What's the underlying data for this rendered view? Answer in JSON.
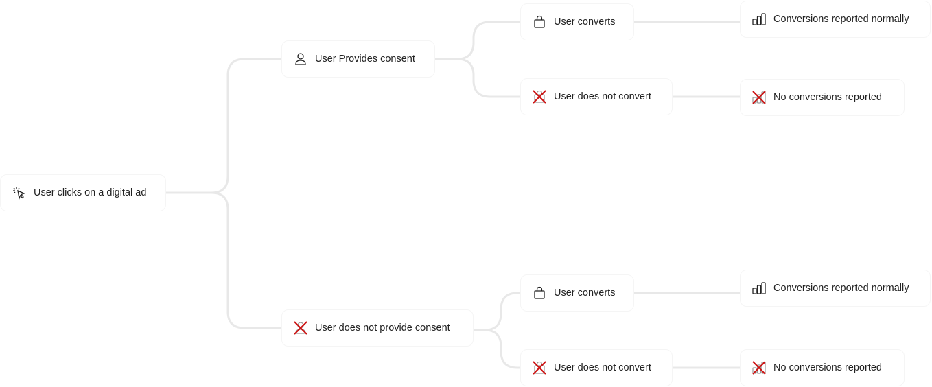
{
  "nodes": {
    "root": {
      "label": "User clicks on a digital ad",
      "icon": "cursor-click-icon"
    },
    "consent": {
      "label": "User Provides consent",
      "icon": "person-icon"
    },
    "no_consent": {
      "label": "User does not provide consent",
      "icon": "person-crossed-icon"
    },
    "consent_converts": {
      "label": "User converts",
      "icon": "shopping-bag-icon"
    },
    "consent_not_convert": {
      "label": "User does not convert",
      "icon": "shopping-bag-crossed-icon"
    },
    "noconsent_converts": {
      "label": "User converts",
      "icon": "shopping-bag-icon"
    },
    "noconsent_not_convert": {
      "label": "User does not convert",
      "icon": "shopping-bag-crossed-icon"
    },
    "out1": {
      "label": "Conversions reported normally",
      "icon": "bar-chart-icon"
    },
    "out2": {
      "label": "No conversions reported",
      "icon": "bar-chart-crossed-icon"
    },
    "out3": {
      "label": "Conversions reported normally",
      "icon": "bar-chart-icon"
    },
    "out4": {
      "label": "No conversions reported",
      "icon": "bar-chart-crossed-icon"
    }
  },
  "colors": {
    "connector": "#e8e8e8",
    "cross": "#cc1111",
    "text": "#222222"
  }
}
